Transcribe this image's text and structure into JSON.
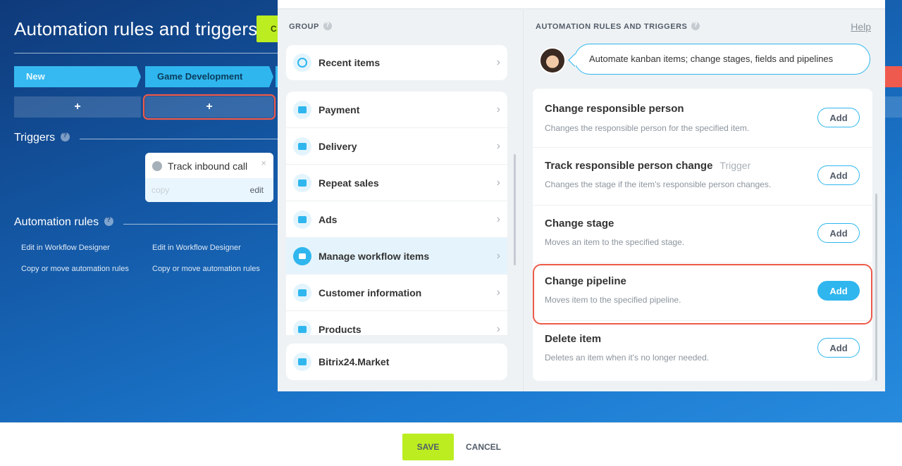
{
  "background": {
    "page_title": "Automation rules and triggers",
    "create_button_label": "C",
    "stages": [
      "New",
      "Game Development"
    ],
    "add_label": "+",
    "triggers_label": "Triggers",
    "trigger_card": {
      "title": "Track inbound call",
      "close": "×",
      "copy": "copy",
      "edit": "edit"
    },
    "automation_rules_label": "Automation rules",
    "rule_links": {
      "edit1": "Edit in Workflow Designer",
      "edit2": "Edit in Workflow Designer",
      "copy1": "Copy or move automation rules",
      "copy2": "Copy or move automation rules"
    }
  },
  "popup": {
    "group_header": "GROUP",
    "recent_items": "Recent items",
    "groups": [
      {
        "label": "Payment",
        "icon": "wallet-icon"
      },
      {
        "label": "Delivery",
        "icon": "truck-icon"
      },
      {
        "label": "Repeat sales",
        "icon": "register-icon"
      },
      {
        "label": "Ads",
        "icon": "megaphone-icon"
      },
      {
        "label": "Manage workflow items",
        "icon": "funnel-icon",
        "active": true
      },
      {
        "label": "Customer information",
        "icon": "contact-card-icon"
      },
      {
        "label": "Products",
        "icon": "cart-icon"
      }
    ],
    "market": "Bitrix24.Market",
    "rules_header": "AUTOMATION RULES AND TRIGGERS",
    "help": "Help",
    "bubble_text": "Automate kanban items; change stages, fields and pipelines",
    "rules": [
      {
        "title": "Change responsible person",
        "trigger": "",
        "desc": "Changes the responsible person for the specified item.",
        "add": "Add"
      },
      {
        "title": "Track responsible person change",
        "trigger": "Trigger",
        "desc": "Changes the stage if the item's responsible person changes.",
        "add": "Add"
      },
      {
        "title": "Change stage",
        "trigger": "",
        "desc": "Moves an item to the specified stage.",
        "add": "Add"
      },
      {
        "title": "Change pipeline",
        "trigger": "",
        "desc": "Moves item to the specified pipeline.",
        "add": "Add"
      },
      {
        "title": "Delete item",
        "trigger": "",
        "desc": "Deletes an item when it's no longer needed.",
        "add": "Add"
      }
    ]
  },
  "footer": {
    "save": "SAVE",
    "cancel": "CANCEL"
  },
  "colors": {
    "accent": "#2fb6ee",
    "save": "#bbed21",
    "highlight": "#ee5a4a"
  }
}
